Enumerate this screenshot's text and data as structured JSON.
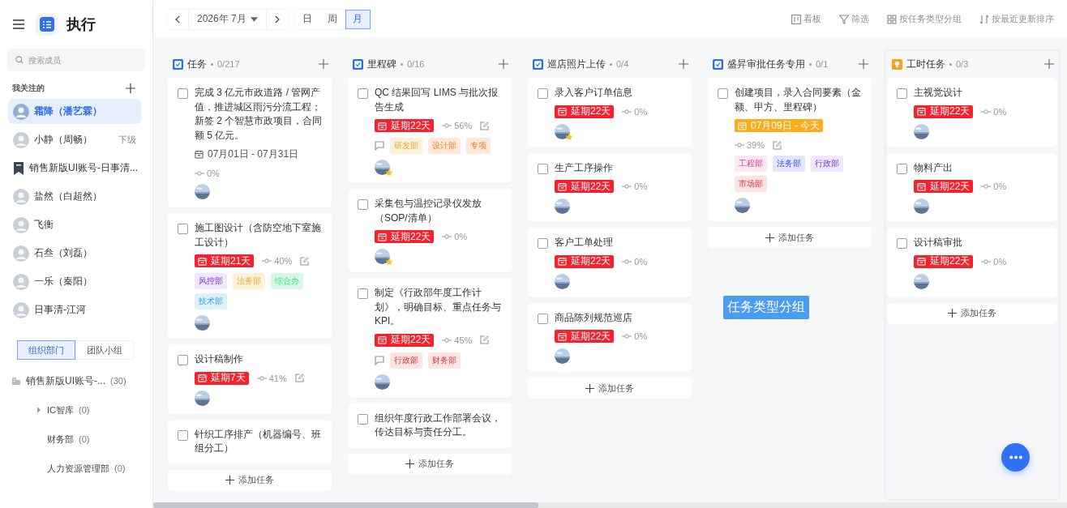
{
  "sidebar": {
    "title": "执行",
    "search": {
      "placeholder": "搜索成员"
    },
    "following_heading": "我关注的",
    "people": [
      {
        "name": "霜降（潘艺霖）",
        "kind": "avatar",
        "selected": true
      },
      {
        "name": "小静（周畅）",
        "kind": "avatar",
        "selected": false,
        "tag": "下级"
      },
      {
        "name": "销售新版UI账号-日事清...",
        "kind": "bookmark",
        "selected": false
      },
      {
        "name": "盐然（白超然）",
        "kind": "avatar",
        "selected": false
      },
      {
        "name": "飞衡",
        "kind": "avatar",
        "selected": false
      },
      {
        "name": "石叁（刘磊）",
        "kind": "avatar",
        "selected": false
      },
      {
        "name": "一乐（秦阳）",
        "kind": "avatar",
        "selected": false
      },
      {
        "name": "日事清-江河",
        "kind": "avatar",
        "selected": false
      }
    ],
    "tabs": [
      {
        "label": "组织部门",
        "selected": true
      },
      {
        "label": "团队小组",
        "selected": false
      }
    ],
    "tree": [
      {
        "name": "销售新版UI账号-...",
        "count": "(30)",
        "children": [
          {
            "name": "IC智库",
            "count": "(0)",
            "expanded": false
          },
          {
            "name": "财务部",
            "count": "(0)"
          },
          {
            "name": "人力资源管理部",
            "count": "(0)"
          }
        ]
      }
    ]
  },
  "toolbar": {
    "month": "2026年 7月",
    "views": [
      {
        "label": "日",
        "selected": false
      },
      {
        "label": "周",
        "selected": false
      },
      {
        "label": "月",
        "selected": true
      }
    ],
    "actions": [
      {
        "kind": "board",
        "label": "看板"
      },
      {
        "kind": "filter",
        "label": "筛选"
      },
      {
        "kind": "group",
        "label": "按任务类型分组"
      },
      {
        "kind": "sort",
        "label": "按最近更新排序"
      }
    ]
  },
  "columns": [
    {
      "title": "任务",
      "count": "0/217",
      "kind": "standard",
      "highlighted": false,
      "add_label": "添加任务",
      "cards": [
        {
          "title": "完成 3 亿元市政道路 / 管网产值，推进城区雨污分流工程；新签 2 个智慧市政项目，合同额 5 亿元。",
          "badge": {
            "kind": "range",
            "text": "07月01日 - 07月31日"
          },
          "progress": "0%",
          "edit": false,
          "comment": false,
          "starred": false
        },
        {
          "title": "施工图设计（含防空地下室施工设计）",
          "badge": {
            "kind": "overdue",
            "text": "延期21天"
          },
          "progress": "40%",
          "edit": true,
          "comment": false,
          "tags": [
            {
              "text": "风控部",
              "color": "#f0e8fe"
            },
            {
              "text": "法务部",
              "color": "#fdf1d9"
            },
            {
              "text": "综合办",
              "color": "#dcf6e6"
            },
            {
              "text": "技术部",
              "color": "#ddf0fc"
            }
          ],
          "starred": false
        },
        {
          "title": "设计稿制作",
          "badge": {
            "kind": "overdue",
            "text": "延期7天"
          },
          "progress": "41%",
          "edit": true,
          "comment": false,
          "starred": false
        },
        {
          "title": "针织工序排产（机器编号、班组分工）"
        }
      ]
    },
    {
      "title": "里程碑",
      "count": "0/16",
      "kind": "standard",
      "highlighted": false,
      "add_label": "添加任务",
      "cards": [
        {
          "title": "QC 结果回写 LIMS 与批次报告生成",
          "badge": {
            "kind": "overdue",
            "text": "延期22天"
          },
          "progress": "56%",
          "edit": true,
          "comment": true,
          "tags": [
            {
              "text": "研发部",
              "color": "#fdf1d9"
            },
            {
              "text": "设计部",
              "color": "#fde9d9"
            },
            {
              "text": "专项",
              "color": "#fde9d9"
            }
          ],
          "starred": true
        },
        {
          "title": "采集包与温控记录仪发放（SOP/清单）",
          "badge": {
            "kind": "overdue",
            "text": "延期22天"
          },
          "progress": "0%",
          "edit": false,
          "comment": false,
          "starred": true
        },
        {
          "title": "制定《行政部年度工作计划》，明确目标、重点任务与KPI。",
          "badge": {
            "kind": "overdue",
            "text": "延期22天"
          },
          "progress": "45%",
          "edit": true,
          "comment": true,
          "tags": [
            {
              "text": "行政部",
              "color": "#fde3e3"
            },
            {
              "text": "财务部",
              "color": "#fde3e3"
            }
          ],
          "starred": false
        },
        {
          "title": "组织年度行政工作部署会议，传达目标与责任分工。"
        }
      ]
    },
    {
      "title": "巡店照片上传",
      "count": "0/4",
      "kind": "standard",
      "highlighted": false,
      "add_label": "添加任务",
      "cards": [
        {
          "title": "录入客户订单信息",
          "badge": {
            "kind": "overdue",
            "text": "延期22天"
          },
          "progress": "0%",
          "edit": false,
          "comment": false,
          "starred": true
        },
        {
          "title": "生产工序操作",
          "badge": {
            "kind": "overdue",
            "text": "延期22天"
          },
          "progress": "0%",
          "edit": false,
          "comment": false,
          "starred": false
        },
        {
          "title": "客户工单处理",
          "badge": {
            "kind": "overdue",
            "text": "延期22天"
          },
          "progress": "0%",
          "edit": false,
          "comment": false,
          "starred": false
        },
        {
          "title": "商品陈列规范巡店",
          "badge": {
            "kind": "overdue",
            "text": "延期22天"
          },
          "progress": "0%",
          "edit": false,
          "comment": false,
          "starred": false
        }
      ]
    },
    {
      "title": "盛昇审批任务专用",
      "count": "0/1",
      "kind": "standard",
      "highlighted": false,
      "add_label": "添加任务",
      "cards": [
        {
          "title": "创建项目，录入合同要素（金额、甲方、里程碑）",
          "badge": {
            "kind": "today",
            "text": "07月09日 - 今天"
          },
          "progress": "39%",
          "edit": true,
          "comment": false,
          "tags": [
            {
              "text": "工程部",
              "color": "#fde8f4"
            },
            {
              "text": "法务部",
              "color": "#e3e7fd"
            },
            {
              "text": "行政部",
              "color": "#f0e8fe"
            },
            {
              "text": "市场部",
              "color": "#fde3e3"
            }
          ],
          "starred": false
        }
      ]
    },
    {
      "title": "工时任务",
      "count": "0/3",
      "kind": "timesheet",
      "highlighted": true,
      "add_label": "添加任务",
      "cards": [
        {
          "title": "主视觉设计",
          "badge": {
            "kind": "overdue",
            "text": "延期22天"
          },
          "progress": "0%",
          "edit": false,
          "comment": false,
          "starred": false
        },
        {
          "title": "物料产出",
          "badge": {
            "kind": "overdue",
            "text": "延期22天"
          },
          "progress": "0%",
          "edit": false,
          "comment": false,
          "starred": false
        },
        {
          "title": "设计稿审批",
          "badge": {
            "kind": "overdue",
            "text": "延期22天"
          },
          "progress": "0%",
          "edit": false,
          "comment": false,
          "starred": false
        }
      ]
    }
  ],
  "group_label": "任务类型分组"
}
